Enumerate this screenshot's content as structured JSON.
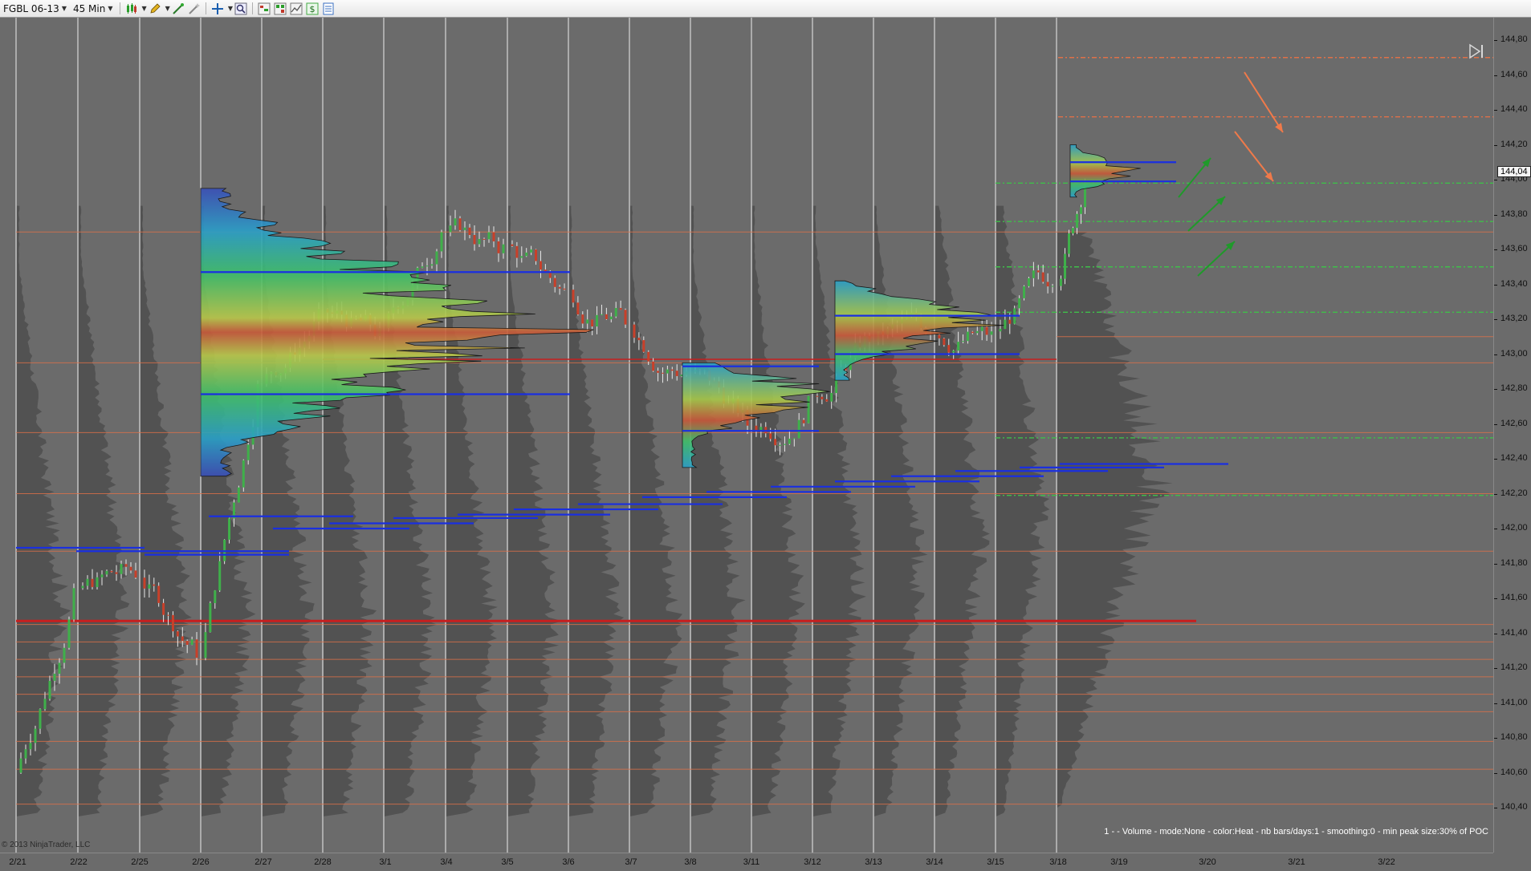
{
  "toolbar": {
    "instrument": "FGBL 06-13",
    "interval": "45 Min"
  },
  "chart": {
    "copyright": "© 2013 NinjaTrader, LLC",
    "indicator_info": "1 -  - Volume - mode:None - color:Heat - nb bars/days:1 - smoothing:0 - min peak size:30% of POC",
    "last_price_label": "144,04",
    "price_ticks": [
      "144,80",
      "144,60",
      "144,40",
      "144,20",
      "144,00",
      "143,80",
      "143,60",
      "143,40",
      "143,20",
      "143,00",
      "142,80",
      "142,60",
      "142,40",
      "142,20",
      "142,00",
      "141,80",
      "141,60",
      "141,40",
      "141,20",
      "141,00",
      "140,80",
      "140,60",
      "140,40"
    ],
    "date_ticks": [
      "2/21",
      "2/22",
      "2/25",
      "2/26",
      "2/27",
      "2/28",
      "3/1",
      "3/4",
      "3/5",
      "3/6",
      "3/7",
      "3/8",
      "3/11",
      "3/12",
      "3/13",
      "3/14",
      "3/15",
      "3/18",
      "3/19",
      "3/20",
      "3/21",
      "3/22"
    ]
  },
  "chart_data": {
    "type": "candlestick",
    "instrument": "FGBL 06-13",
    "interval": "45 Min",
    "ylim": [
      140.3,
      144.9
    ],
    "last_price": 144.04,
    "session_approx_close": [
      {
        "date": "2/21",
        "close": 141.6
      },
      {
        "date": "2/22",
        "close": 141.75
      },
      {
        "date": "2/25",
        "close": 141.3
      },
      {
        "date": "2/26",
        "close": 142.8
      },
      {
        "date": "2/27",
        "close": 143.2
      },
      {
        "date": "2/28",
        "close": 143.1
      },
      {
        "date": "3/1",
        "close": 143.7
      },
      {
        "date": "3/4",
        "close": 143.6
      },
      {
        "date": "3/5",
        "close": 143.35
      },
      {
        "date": "3/6",
        "close": 143.2
      },
      {
        "date": "3/7",
        "close": 142.9
      },
      {
        "date": "3/8",
        "close": 142.6
      },
      {
        "date": "3/11",
        "close": 142.7
      },
      {
        "date": "3/12",
        "close": 143.1
      },
      {
        "date": "3/13",
        "close": 143.15
      },
      {
        "date": "3/14",
        "close": 143.1
      },
      {
        "date": "3/15",
        "close": 143.45
      },
      {
        "date": "3/18",
        "close": 144.0
      }
    ]
  }
}
